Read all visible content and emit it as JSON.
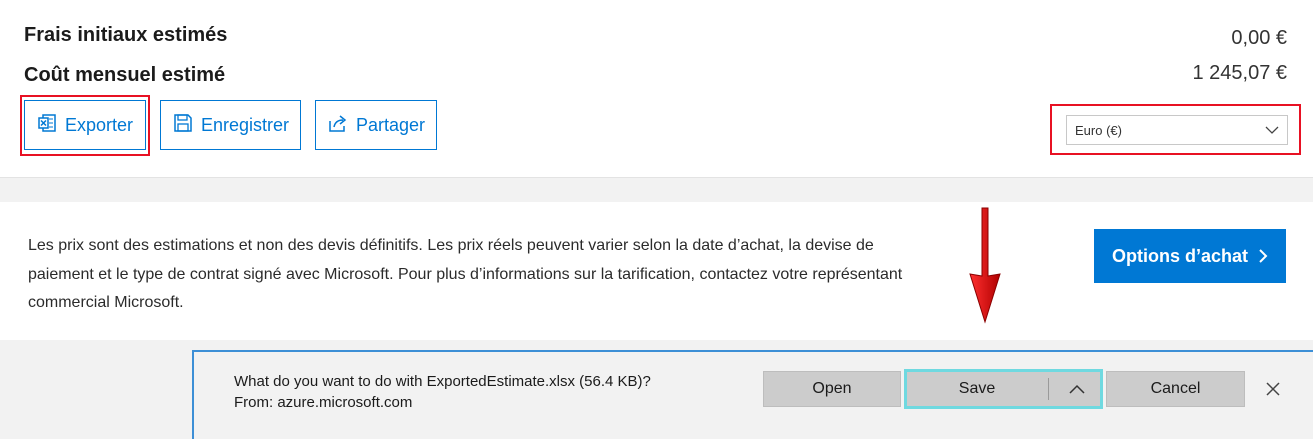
{
  "summary": {
    "initial_label": "Frais initiaux estimés",
    "initial_value": "0,00 €",
    "monthly_label": "Coût mensuel estimé",
    "monthly_value": "1 245,07 €"
  },
  "actions": {
    "export_label": "Exporter",
    "save_label": "Enregistrer",
    "share_label": "Partager"
  },
  "currency": {
    "selected": "Euro (€)"
  },
  "info": {
    "text": "Les prix sont des estimations et non des devis définitifs. Les prix réels peuvent varier selon la date d’achat, la devise de paiement et le type de contrat signé avec Microsoft. Pour plus d’informations sur la tarification, contactez votre représentant commercial Microsoft.",
    "purchase_button": "Options d’achat"
  },
  "download_bar": {
    "question": "What do you want to do with ExportedEstimate.xlsx (56.4 KB)?",
    "source": "From: azure.microsoft.com",
    "open_label": "Open",
    "save_label": "Save",
    "cancel_label": "Cancel"
  },
  "colors": {
    "accent": "#0078d4",
    "highlight": "#e81123",
    "download_focus": "#6fd9e0"
  }
}
